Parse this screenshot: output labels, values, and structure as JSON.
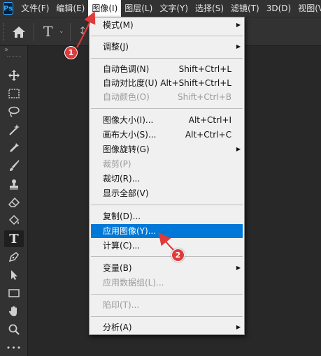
{
  "app": {
    "logo_text": "Ps"
  },
  "menubar": {
    "items": [
      {
        "label": "文件(F)"
      },
      {
        "label": "编辑(E)"
      },
      {
        "label": "图像(I)"
      },
      {
        "label": "图层(L)"
      },
      {
        "label": "文字(Y)"
      },
      {
        "label": "选择(S)"
      },
      {
        "label": "滤镜(T)"
      },
      {
        "label": "3D(D)"
      },
      {
        "label": "视图(V)"
      }
    ],
    "active": "图像(I)"
  },
  "options_bar": {
    "tool_glyph": "T",
    "caret": "⌄",
    "orientation_glyph": "↕"
  },
  "toolbar": {
    "collapse_glyph": "»",
    "tools": [
      {
        "name": "move-tool-icon"
      },
      {
        "name": "marquee-tool-icon"
      },
      {
        "name": "lasso-tool-icon"
      },
      {
        "name": "magic-wand-tool-icon"
      },
      {
        "name": "eyedropper-tool-icon"
      },
      {
        "name": "brush-tool-icon"
      },
      {
        "name": "stamp-tool-icon"
      },
      {
        "name": "eraser-tool-icon"
      },
      {
        "name": "paint-bucket-tool-icon"
      },
      {
        "name": "type-tool-icon",
        "glyph": "T",
        "selected": true
      },
      {
        "name": "pen-tool-icon"
      },
      {
        "name": "path-selection-tool-icon"
      },
      {
        "name": "rectangle-tool-icon"
      },
      {
        "name": "hand-tool-icon"
      },
      {
        "name": "zoom-tool-icon"
      },
      {
        "name": "more-tools-icon",
        "glyph": "•••"
      }
    ]
  },
  "image_menu": {
    "items": [
      {
        "label": "模式(M)",
        "submenu": true
      },
      {
        "label": "调整(J)",
        "submenu": true
      },
      {
        "label": "自动色调(N)",
        "shortcut": "Shift+Ctrl+L"
      },
      {
        "label": "自动对比度(U)",
        "shortcut": "Alt+Shift+Ctrl+L"
      },
      {
        "label": "自动颜色(O)",
        "shortcut": "Shift+Ctrl+B",
        "disabled": true
      },
      {
        "label": "图像大小(I)...",
        "shortcut": "Alt+Ctrl+I"
      },
      {
        "label": "画布大小(S)...",
        "shortcut": "Alt+Ctrl+C"
      },
      {
        "label": "图像旋转(G)",
        "submenu": true
      },
      {
        "label": "裁剪(P)",
        "disabled": true
      },
      {
        "label": "裁切(R)..."
      },
      {
        "label": "显示全部(V)"
      },
      {
        "label": "复制(D)..."
      },
      {
        "label": "应用图像(Y)...",
        "highlighted": true
      },
      {
        "label": "计算(C)..."
      },
      {
        "label": "变量(B)",
        "submenu": true
      },
      {
        "label": "应用数据组(L)...",
        "disabled": true
      },
      {
        "label": "陷印(T)...",
        "disabled": true
      },
      {
        "label": "分析(A)",
        "submenu": true
      }
    ],
    "submenu_arrow": "▶"
  },
  "annotations": {
    "step1": "1",
    "step2": "2",
    "color": "#e03a3a"
  },
  "colors": {
    "menu_highlight": "#0078d7",
    "app_dark": "#323232",
    "canvas": "#282828"
  }
}
